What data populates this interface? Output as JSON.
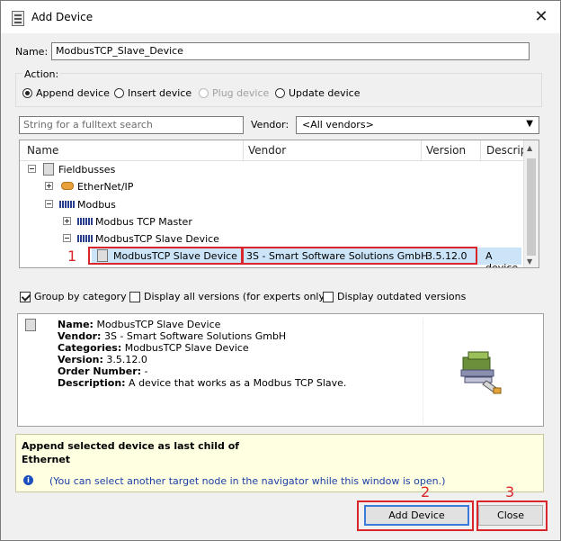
{
  "window": {
    "title": "Add Device",
    "close_glyph": "✕"
  },
  "name_field": {
    "label": "Name:",
    "value": "ModbusTCP_Slave_Device"
  },
  "action": {
    "label": "Action:",
    "options": [
      {
        "label": "Append device",
        "selected": true,
        "disabled": false
      },
      {
        "label": "Insert device",
        "selected": false,
        "disabled": false
      },
      {
        "label": "Plug device",
        "selected": false,
        "disabled": true
      },
      {
        "label": "Update device",
        "selected": false,
        "disabled": false
      }
    ]
  },
  "search": {
    "placeholder": "String for a fulltext search"
  },
  "vendor": {
    "label": "Vendor:",
    "value": "<All vendors>"
  },
  "grid": {
    "columns": [
      "Name",
      "Vendor",
      "Version",
      "Descript"
    ],
    "rows": [
      {
        "name": "Fieldbusses",
        "vendor": "",
        "version": "",
        "desc": ""
      },
      {
        "name": "EtherNet/IP",
        "vendor": "",
        "version": "",
        "desc": ""
      },
      {
        "name": "Modbus",
        "vendor": "",
        "version": "",
        "desc": ""
      },
      {
        "name": "Modbus TCP Master",
        "vendor": "",
        "version": "",
        "desc": ""
      },
      {
        "name": "ModbusTCP Slave Device",
        "vendor": "",
        "version": "",
        "desc": ""
      },
      {
        "name": "ModbusTCP Slave Device",
        "vendor": "3S - Smart Software Solutions GmbH",
        "version": "3.5.12.0",
        "desc": "A device"
      }
    ]
  },
  "options": {
    "group_by_category": {
      "label": "Group by category",
      "checked": true
    },
    "display_all_versions": {
      "label": "Display all versions (for experts only)",
      "checked": false
    },
    "display_outdated": {
      "label": "Display outdated versions",
      "checked": false
    }
  },
  "description": {
    "name_key": "Name:",
    "name_val": "ModbusTCP Slave Device",
    "vendor_key": "Vendor:",
    "vendor_val": "3S - Smart Software Solutions GmbH",
    "categories_key": "Categories:",
    "categories_val": "ModbusTCP Slave Device",
    "version_key": "Version:",
    "version_val": "3.5.12.0",
    "order_key": "Order Number:",
    "order_val": "-",
    "desc_key": "Description:",
    "desc_val": "A device that works as a Modbus TCP Slave."
  },
  "info": {
    "line1": "Append selected device as last child of",
    "line2": "Ethernet",
    "hint": "(You can select another target node in the navigator while this window is open.)"
  },
  "buttons": {
    "add": "Add Device",
    "close": "Close"
  },
  "annotations": {
    "a1": "1",
    "a2": "2",
    "a3": "3"
  },
  "colors": {
    "highlight": "#d9262a",
    "selection": "#cce4f7",
    "info_bg": "#ffffe1"
  }
}
